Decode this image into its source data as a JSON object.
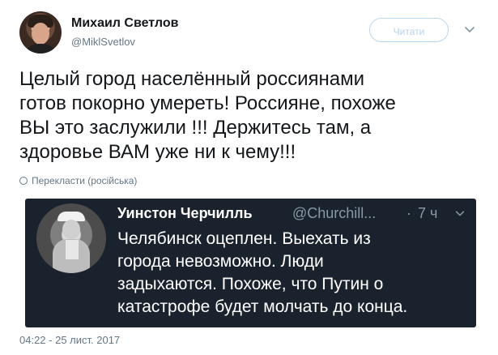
{
  "author": {
    "name": "Михаил Светлов",
    "handle": "@MiklSvetlov"
  },
  "header": {
    "follow_label": "Читати"
  },
  "tweet": {
    "text_lines": [
      "Целый город населённый россиянами",
      "готов покорно умереть! Россияне, похоже",
      "ВЫ это заслужили !!! Держитесь там, а",
      "здоровье ВАМ уже ни к чему!!!"
    ],
    "translate_label": "Перекласти (російська)",
    "timestamp": "04:22 - 25 лист. 2017"
  },
  "quote": {
    "name": "Уинстон Черчилль",
    "handle": "@Churchill...",
    "dot": "·",
    "time": "7 ч",
    "text_lines": [
      "Челябинск оцеплен. Выехать из",
      "города невозможно. Люди",
      "задыхаются. Похоже, что Путин о",
      "катастрофе будет молчать до конца."
    ]
  },
  "icons": {
    "header_chevron": "chevron-down-icon",
    "quote_chevron": "chevron-down-icon",
    "translate": "globe-icon"
  },
  "colors": {
    "quote_background": "#1a232d",
    "muted": "#657786",
    "follow_border": "#b8d7f2"
  }
}
